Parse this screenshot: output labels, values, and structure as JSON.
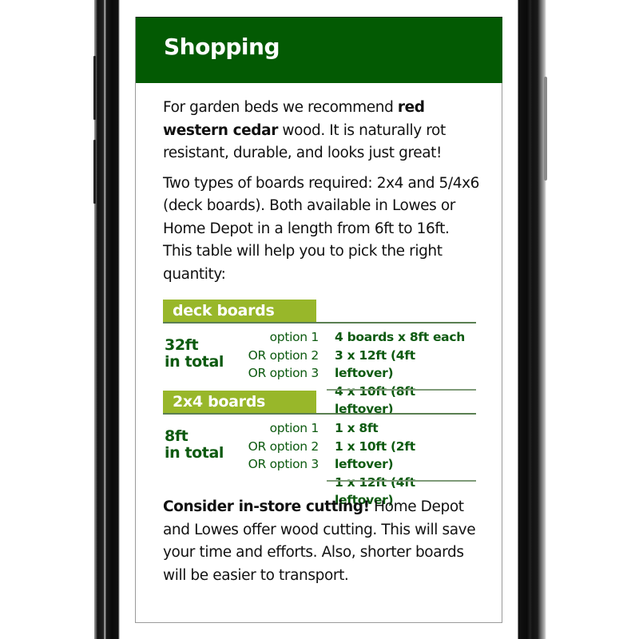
{
  "header": {
    "title": "Shopping"
  },
  "intro": {
    "before": "For garden beds we recommend ",
    "bold": "red western cedar",
    "after": " wood. It is naturally rot resistant, durable, and looks just great!"
  },
  "boards_info": "Two types of boards required: 2x4 and 5/4x6 (deck boards). Both available in Lowes or Home Depot in a length from 6ft to 16ft. This table will help you to pick the right quantity:",
  "table": {
    "sections": [
      {
        "label": "deck boards",
        "total_line1": "32ft",
        "total_line2": "in total",
        "options": [
          {
            "label": "option 1",
            "value": "4 boards x 8ft each"
          },
          {
            "label": "OR option 2",
            "value": "3 x 12ft (4ft leftover)"
          },
          {
            "label": "OR option 3",
            "value": "4 x 10ft (8ft leftover)"
          }
        ]
      },
      {
        "label": "2x4 boards",
        "total_line1": "8ft",
        "total_line2": "in total",
        "options": [
          {
            "label": "option 1",
            "value": "1 x 8ft"
          },
          {
            "label": "OR option 2",
            "value": "1 x 10ft (2ft leftover)"
          },
          {
            "label": "OR option 3",
            "value": "1 x 12ft (4ft leftover)"
          }
        ]
      }
    ]
  },
  "tip": {
    "bold": "Consider in-store cutting!",
    "text": " Home Depot and Lowes offer wood cutting. This will save your time and efforts. Also, shorter boards will be easier to transport."
  },
  "colors": {
    "header_bg": "#035a03",
    "section_label_bg": "#98b72a",
    "table_text": "#0d5a10"
  }
}
